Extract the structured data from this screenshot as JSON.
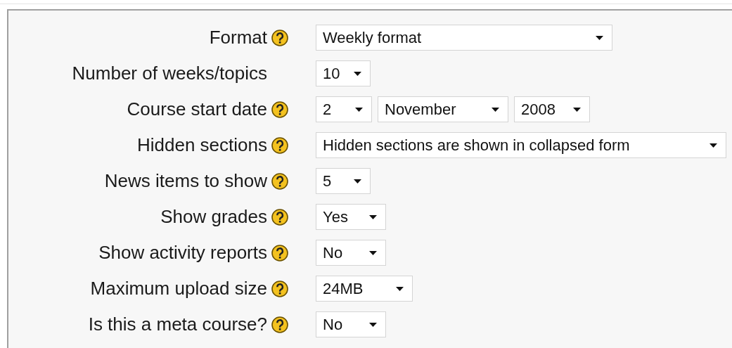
{
  "settings": [
    {
      "label": "Format",
      "help": true,
      "selects": [
        "Weekly format"
      ]
    },
    {
      "label": "Number of weeks/topics",
      "help": false,
      "selects": [
        "10"
      ]
    },
    {
      "label": "Course start date",
      "help": true,
      "selects": [
        "2",
        "November",
        "2008"
      ]
    },
    {
      "label": "Hidden sections",
      "help": true,
      "selects": [
        "Hidden sections are shown in collapsed form"
      ]
    },
    {
      "label": "News items to show",
      "help": true,
      "selects": [
        "5"
      ]
    },
    {
      "label": "Show grades",
      "help": true,
      "selects": [
        "Yes"
      ]
    },
    {
      "label": "Show activity reports",
      "help": true,
      "selects": [
        "No"
      ]
    },
    {
      "label": "Maximum upload size",
      "help": true,
      "selects": [
        "24MB"
      ]
    },
    {
      "label": "Is this a meta course?",
      "help": true,
      "selects": [
        "No"
      ]
    }
  ]
}
